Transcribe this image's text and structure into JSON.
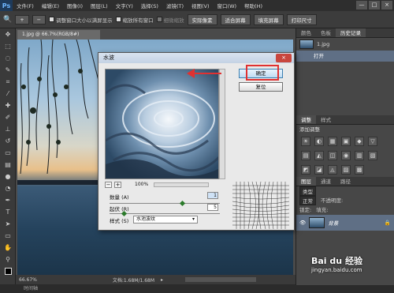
{
  "app": {
    "logo": "Ps"
  },
  "menu": [
    "文件(F)",
    "编辑(E)",
    "图像(I)",
    "图层(L)",
    "文字(Y)",
    "选择(S)",
    "滤镜(T)",
    "视图(V)",
    "窗口(W)",
    "帮助(H)"
  ],
  "window_controls": [
    "—",
    "□",
    "×"
  ],
  "options_bar": {
    "resize_label": "调整窗口大小以满屏显示",
    "zoom_all_label": "缩放所有窗口",
    "scrubby_label": "细微缩放",
    "btn_actual": "实际像素",
    "btn_fit": "适合屏幕",
    "btn_fill": "填充屏幕",
    "btn_print": "打印尺寸"
  },
  "document": {
    "tab_title": "1.jpg @ 66.7%(RGB/8#)",
    "zoom": "66.67%",
    "doc_info": "文档:1.68M/1.68M"
  },
  "bottom_strip": "时间轴",
  "right_panel": {
    "tabs_top": [
      "颜色",
      "色板",
      "历史记录"
    ],
    "history_snapshot": "1.jpg",
    "history_open": "打开",
    "tabs_mid": [
      "调整",
      "样式"
    ],
    "adjust_title": "添加调整",
    "adjust_icons_row1": [
      "☀",
      "◐",
      "▦",
      "▣",
      "◆",
      "▽"
    ],
    "adjust_icons_row2": [
      "▤",
      "◭",
      "◫",
      "◉",
      "▥",
      "▧"
    ],
    "adjust_icons_row3": [
      "◩",
      "◪",
      "◬",
      "▨",
      "▩"
    ],
    "tabs_layers": [
      "图层",
      "通道",
      "路径"
    ],
    "kind_label": "类型",
    "blend_mode": "正常",
    "opacity_label": "不透明度:",
    "lock_label": "锁定:",
    "fill_label": "填充:",
    "layer_name": "背景",
    "layer_lock": "🔒"
  },
  "dialog": {
    "title": "水波",
    "close": "×",
    "ok": "确定",
    "reset": "复位",
    "zoom_minus": "−",
    "zoom_plus": "+",
    "zoom_value": "100%",
    "amount_label": "数量 (A)",
    "amount_value": "1",
    "ridges_label": "起伏 (R)",
    "ridges_value": "5",
    "style_label": "样式 (S)",
    "style_value": "水池波纹"
  },
  "watermark": {
    "site": "Bai du 经验",
    "url": "jingyan.baidu.com"
  },
  "colors": {
    "highlight": "#e03131",
    "accent": "#3c7fb1"
  }
}
